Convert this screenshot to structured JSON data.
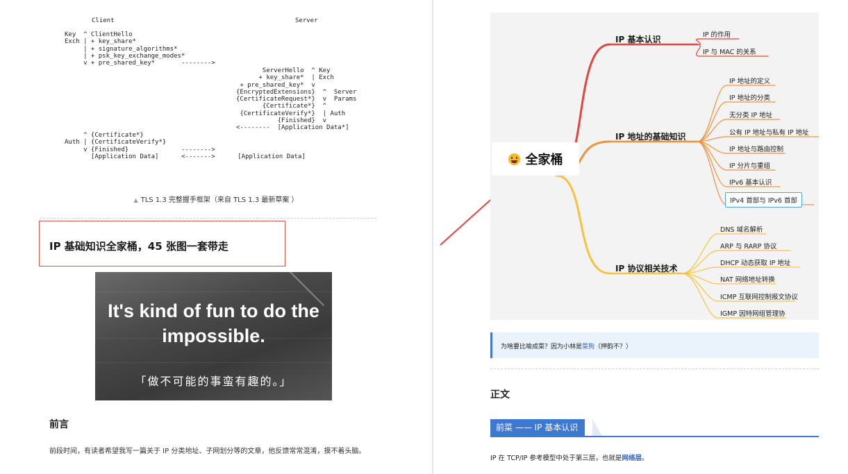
{
  "left_page": {
    "tls": {
      "client_label": "Client",
      "server_label": "Server",
      "client_block": "Key  ^ ClientHello\nExch | + key_share*\n     | + signature_algorithms*\n     | + psk_key_exchange_modes*\n     v + pre_shared_key*       -------->",
      "server_block": "       ServerHello  ^ Key\n      + key_share*  | Exch\n + pre_shared_key*  v\n{EncryptedExtensions}  ^  Server\n{CertificateRequest*}  v  Params\n       {Certificate*}  ^\n {CertificateVerify*}  | Auth\n           {Finished}  v\n<--------  [Application Data*]",
      "client_final": "     ^ {Certificate*}\nAuth | {CertificateVerify*}\n     v {Finished}              -------->\n       [Application Data]      <------->      [Application Data]",
      "caption": "TLS 1.3 完整握手框架（来自 TLS 1.3 最新草案 ）"
    },
    "article_title": "IP 基础知识全家桶，45 张图一套带走",
    "hero": {
      "quote_line1": "It's kind of fun to do the",
      "quote_line2": "impossible.",
      "quote_cn": "「做不可能的事蛮有趣的。」"
    },
    "preface_heading": "前言",
    "preface_text": "前段时间，有读者希望我写一篇关于 IP 分类地址、子网划分等的文章，他反馈常常混淆，摸不着头脑。"
  },
  "mindmap": {
    "root": "全家桶",
    "branches": [
      {
        "label": "IP 基本认识",
        "color": "#e8433c",
        "children": [
          "IP 的作用",
          "IP 与 MAC 的关系"
        ]
      },
      {
        "label": "IP 地址的基础知识",
        "color": "#f2913a",
        "children": [
          "IP 地址的定义",
          "IP 地址的分类",
          "无分类 IP 地址",
          "公有 IP 地址与私有 IP 地址",
          "IP 地址与路由控制",
          "IP 分片与重组",
          "IPv6 基本认识",
          "IPv4 首部与 IPv6 首部"
        ]
      },
      {
        "label": "IP 协议相关技术",
        "color": "#f6c43c",
        "children": [
          "DNS 域名解析",
          "ARP 与 RARP 协议",
          "DHCP 动态获取 IP 地址",
          "NAT 网络地址转换",
          "ICMP 互联网控制报文协议",
          "IGMP 因特网组管理协"
        ]
      }
    ],
    "selected_leaf": "IPv4 首部与 IPv6 首部",
    "arrow_color": "#e8433c"
  },
  "note": {
    "prefix": "为啥要比喻成菜？因为小林是",
    "link": "菜狗",
    "suffix": "（押韵不？）"
  },
  "body_heading": "正文",
  "sub_heading": "前菜 —— IP 基本认识",
  "body_text": {
    "prefix": "IP 在 TCP/IP 参考模型中处于第三层，也就是",
    "link": "网络层",
    "suffix": "。"
  }
}
